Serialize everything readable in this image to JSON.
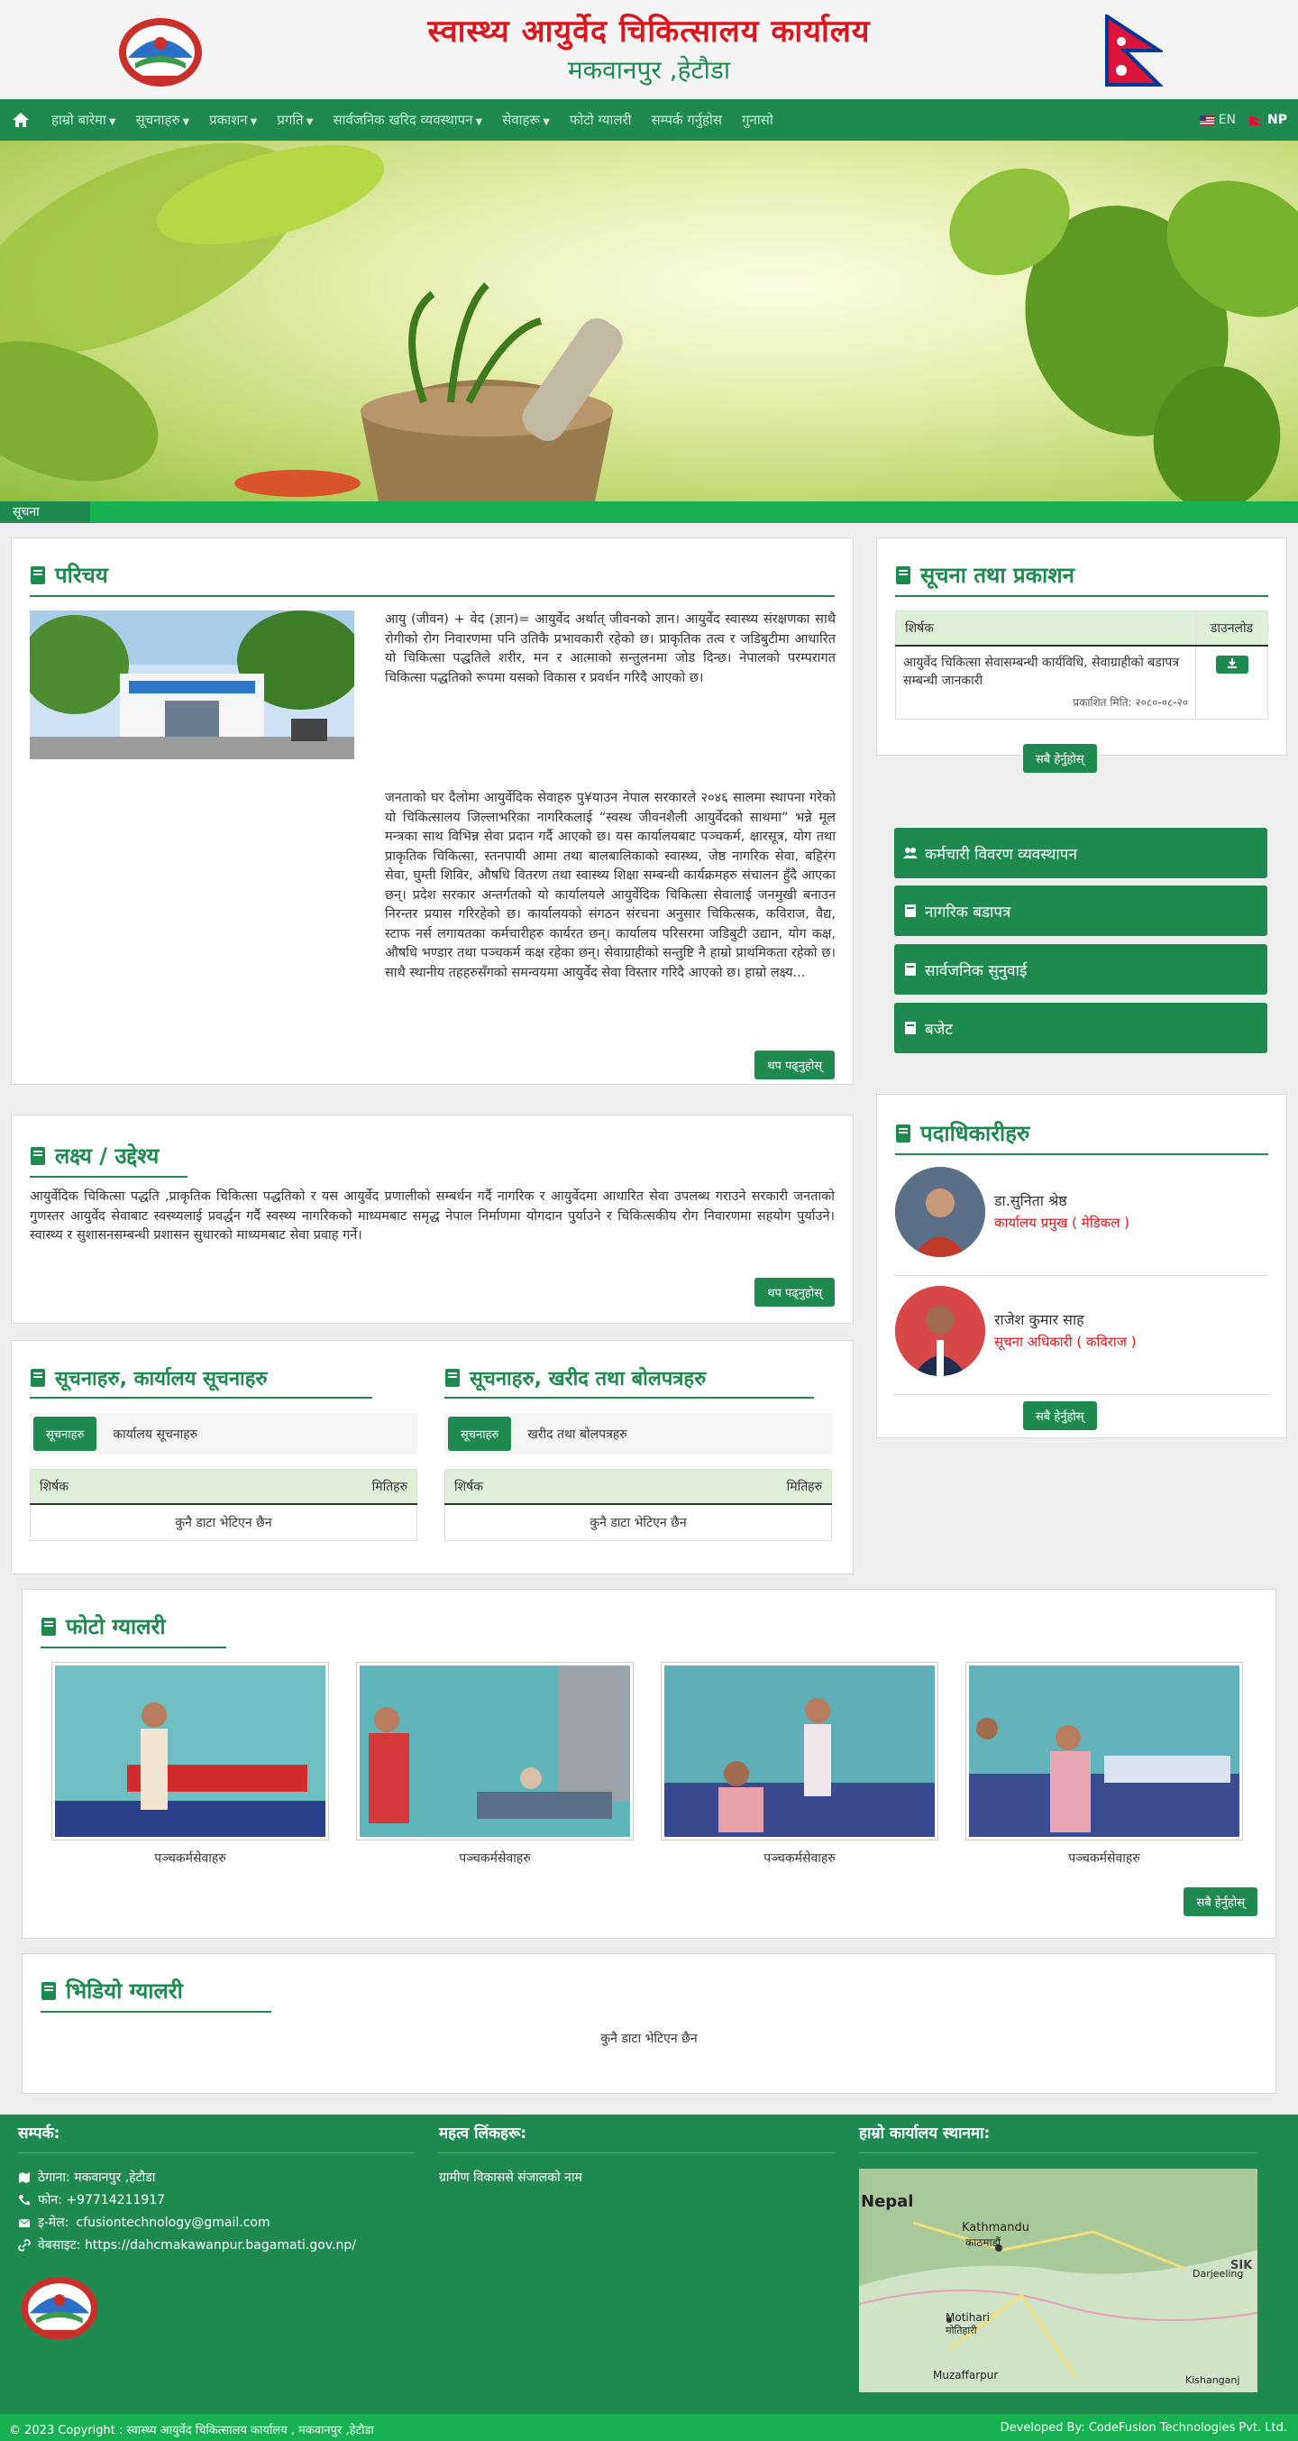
{
  "header": {
    "org_name": "स्वास्थ्य आयुर्वेद चिकित्सालय कार्यालय",
    "org_location": "मकवानपुर ,हेटौडा"
  },
  "nav": {
    "items": [
      {
        "label": "हाम्रो बारेमा",
        "dropdown": true
      },
      {
        "label": "सूचनाहरु",
        "dropdown": true
      },
      {
        "label": "प्रकाशन",
        "dropdown": true
      },
      {
        "label": "प्रगति",
        "dropdown": true
      },
      {
        "label": "सार्वजनिक खरिद व्यवस्थापन",
        "dropdown": true
      },
      {
        "label": "सेवाहरू",
        "dropdown": true
      },
      {
        "label": "फोटो ग्यालरी",
        "dropdown": false
      },
      {
        "label": "सम्पर्क गर्नुहोस",
        "dropdown": false
      },
      {
        "label": "गुनासो",
        "dropdown": false
      }
    ],
    "lang_en": "EN",
    "lang_np": "NP"
  },
  "ticker": {
    "label": "सूचना"
  },
  "about": {
    "title": "परिचय",
    "para1": "आयु (जीवन) + वेद (ज्ञान)= आयुर्वेद अर्थात् जीवनको ज्ञान। आयुर्वेद स्वास्थ्य संरक्षणका साथै रोगीको रोग निवारणमा पनि उतिकै प्रभावकारी रहेको छ। प्राकृतिक तत्व र जडिबुटीमा आधारित यो चिकित्सा पद्धतिले शरीर, मन र आत्माको सन्तुलनमा जोड दिन्छ। नेपालको परम्परागत चिकित्सा पद्धतिको रूपमा यसको विकास र प्रवर्धन गरिदै आएको छ।",
    "para2": "जनताको घर दैलोमा आयुर्वेदिक सेवाहरु पु¥याउन नेपाल सरकारले २०४६ सालमा स्थापना गरेको यो चिकित्सालय जिल्लाभरिका नागरिकलाई “स्वस्थ जीवनशैली आयुर्वेदको साथमा” भन्ने मूल मन्त्रका साथ विभिन्न सेवा प्रदान गर्दै आएको छ। यस कार्यालयबाट पञ्चकर्म, क्षारसूत्र, योग तथा प्राकृतिक चिकित्सा, स्तनपायी आमा तथा बालबालिकाको स्वास्थ्य, जेष्ठ नागरिक सेवा, बहिरंग सेवा, घुम्ती शिविर, औषधि वितरण तथा स्वास्थ्य शिक्षा सम्बन्धी कार्यक्रमहरु संचालन हुँदै आएका छन्। प्रदेश सरकार अन्तर्गतको यो कार्यालयले आयुर्वेदिक चिकित्सा सेवालाई जनमुखी बनाउन निरन्तर प्रयास गरिरहेको छ। कार्यालयको संगठन संरचना अनुसार चिकित्सक, कविराज, वैद्य, स्टाफ नर्स लगायतका कर्मचारीहरु कार्यरत छन्। कार्यालय परिसरमा जडिबुटी उद्यान, योग कक्ष, औषधि भण्डार तथा पञ्चकर्म कक्ष रहेका छन्। सेवाग्राहीको सन्तुष्टि नै हाम्रो प्राथमिकता रहेको छ। साथै स्थानीय तहहरुसँगको समन्वयमा आयुर्वेद सेवा विस्तार गरिदै आएको छ। हाम्रो लक्ष्य...",
    "read_more": "थप पढ्नुहोस्"
  },
  "mission": {
    "title": "लक्ष्य / उद्देश्य",
    "text": "आयुर्वेदिक चिकित्सा पद्धति ,प्राकृतिक चिकित्सा पद्धतिको र यस आयुर्वेद प्रणालीको सम्बर्धन गर्दै नागरिक र आयुर्वेदमा आधारित सेवा उपलब्ध गराउने  सरकारी जनताको गुणस्तर आयुर्वेद सेवाबाट स्वस्थ्यलाई प्रवर्द्धन गर्दै स्वस्थ्य नागरिकको माध्यमबाट समृद्ध नेपाल निर्माणमा योगदान पुर्याउने र चिकित्सकीय रोग निवारणमा सहयोग पुर्याउने। स्वास्थ्य र सुशासनसम्बन्धी  प्रशासन सुधारको माध्यमबाट सेवा प्रवाह गर्ने।",
    "read_more": "थप पढ्नुहोस्"
  },
  "public_notices": {
    "title": "सूचना तथा प्रकाशन",
    "col_title": "शिर्षक",
    "col_download": "डाउनलोड",
    "row_title": "आयुर्वेद चिकित्सा सेवासम्बन्धी कार्यविधि, सेवाग्राहीको बडापत्र सम्बन्धी जानकारी",
    "row_date": "प्रकाशित मिति: २०८०-०८-२०",
    "view_all": "सबै हेर्नुहोस्"
  },
  "quick_links": [
    {
      "label": "कर्मचारी विवरण व्यवस्थापन",
      "icon": "users-icon"
    },
    {
      "label": "नागरिक बडापत्र",
      "icon": "book-icon"
    },
    {
      "label": "सार्वजनिक सुनुवाई",
      "icon": "book-icon"
    },
    {
      "label": "बजेट",
      "icon": "book-icon"
    }
  ],
  "officials": {
    "title": "पदाधिकारीहरु",
    "people": [
      {
        "name": "डा.सुनिता श्रेष्ठ",
        "role": "कार्यालय प्रमुख ( मेडिकल )"
      },
      {
        "name": "राजेश कुमार साह",
        "role": "सूचना अधिकारी ( कविराज )"
      }
    ],
    "view_all": "सबै हेर्नुहोस्"
  },
  "notice_panels": [
    {
      "title": "सूचनाहरु, कार्यालय सूचनाहरु",
      "tab_active": "सूचनाहरु",
      "tab_other": "कार्यालय सूचनाहरु",
      "col_title": "शिर्षक",
      "col_date": "मितिहरु",
      "empty": "कुनै डाटा भेटिएन छैन"
    },
    {
      "title": "सूचनाहरु, खरीद तथा बोलपत्रहरु",
      "tab_active": "सूचनाहरु",
      "tab_other": "खरीद तथा बोलपत्रहरु",
      "col_title": "शिर्षक",
      "col_date": "मितिहरु",
      "empty": "कुनै डाटा भेटिएन छैन"
    }
  ],
  "gallery": {
    "title": "फोटो ग्यालरी",
    "captions": [
      "पञ्चकर्मसेवाहरु",
      "पञ्चकर्मसेवाहरु",
      "पञ्चकर्मसेवाहरु",
      "पञ्चकर्मसेवाहरु"
    ],
    "view_all": "सबै हेर्नुहोस्"
  },
  "videos": {
    "title": "भिडियो ग्यालरी",
    "empty": "कुनै डाटा भेटिएन छैन"
  },
  "footer": {
    "contact_title": "सम्पर्क:",
    "address": "ठेगाना: मकवानपुर ,हेटौडा",
    "phone": "फोन: +97714211917",
    "email_label": "इ-मेल:",
    "email": "cfusiontechnology@gmail.com",
    "website": "वेबसाइट: https://dahcmakawanpur.bagamati.gov.np/",
    "links_title": "महत्व लिंकहरू:",
    "link1": "ग्रामीण विकाससे संजालको नाम",
    "map_title": "हाम्रो कार्यालय स्थानमा:",
    "map_labels": {
      "country": "Nepal",
      "city": "Kathmandu",
      "city_np": "काठमाडौं",
      "motihari": "Motihari",
      "motihari_np": "मोतिहारी",
      "muzaffarpur": "Muzaffarpur",
      "darjeeling": "Darjeeling",
      "kishanganj": "Kishanganj",
      "sik": "SIK"
    }
  },
  "copyright": {
    "left": "© 2023 Copyright : स्वास्थ्य आयुर्वेद चिकित्सालय कार्यालय , मकवानपुर ,हेटौडा",
    "right": "Developed By: CodeFusion Technologies Pvt. Ltd."
  },
  "colors": {
    "brand_green": "#1e8a4f",
    "ticker_green": "#18b152",
    "title_red": "#d9171f"
  }
}
